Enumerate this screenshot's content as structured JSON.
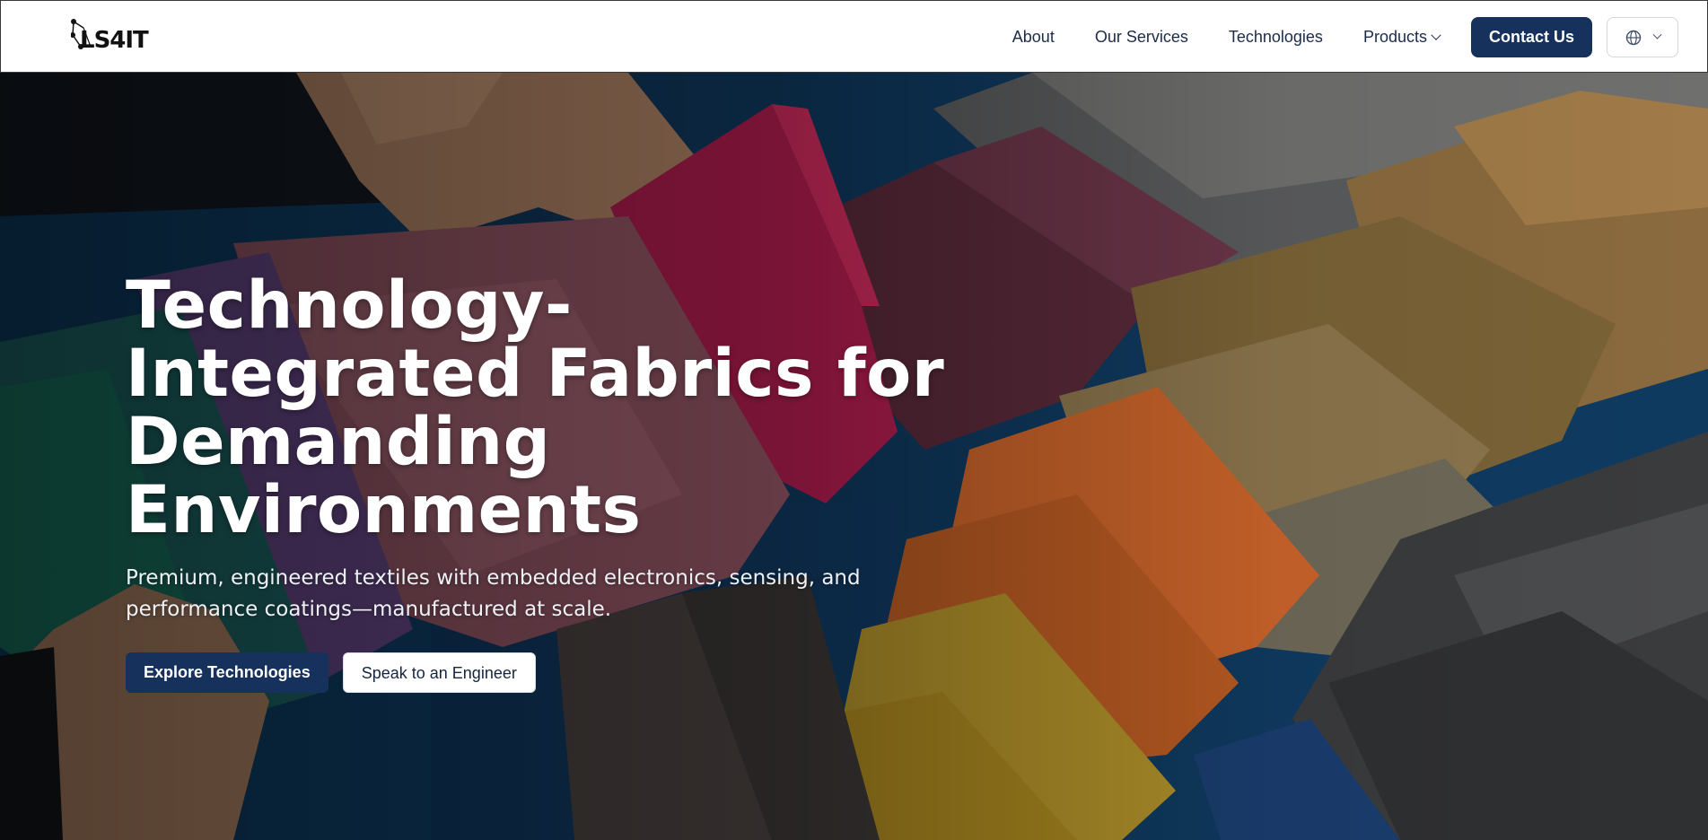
{
  "brand": {
    "logo_text": "LS4IT"
  },
  "nav": {
    "items": [
      {
        "label": "About"
      },
      {
        "label": "Our Services"
      },
      {
        "label": "Technologies"
      },
      {
        "label": "Products",
        "has_dropdown": true
      }
    ],
    "contact_label": "Contact Us",
    "language_icon": "globe-icon"
  },
  "hero": {
    "title": "Technology-Integrated Fabrics for Demanding Environments",
    "subtitle": "Premium, engineered textiles with embedded electronics, sensing, and performance coatings—manufactured at scale.",
    "primary_cta": "Explore Technologies",
    "secondary_cta": "Speak to an Engineer",
    "background_image": "fabric-swatches-photo"
  },
  "colors": {
    "brand_navy": "#16325c",
    "nav_text": "#1b2b4a",
    "hero_text": "#ffffff"
  }
}
